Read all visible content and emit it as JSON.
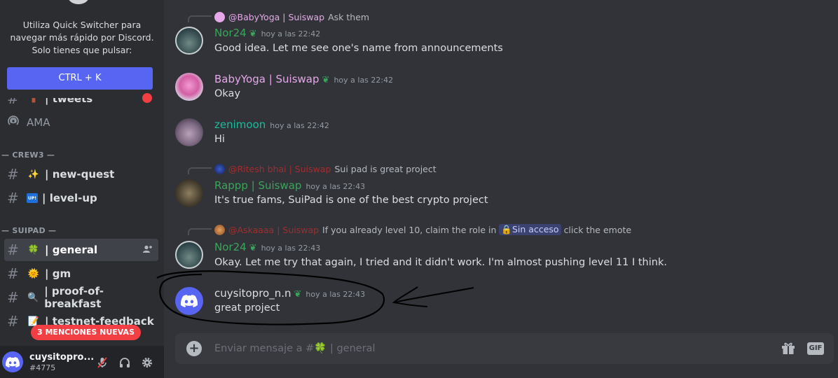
{
  "quick_switcher": {
    "line1": "Utiliza Quick Switcher para",
    "line2": "navegar más rápido por Discord.",
    "line3": "Solo tienes que pulsar:",
    "button": "CTRL + K"
  },
  "sidebar": {
    "partial_channel": "| tweets",
    "ama": "AMA",
    "categories": [
      "— CREW3 —",
      "— SUIPAD —"
    ],
    "crew3_channels": [
      {
        "emoji": "✨",
        "name": "| new-quest"
      },
      {
        "emoji": "UP!",
        "name": "| level-up"
      }
    ],
    "suipad_channels": [
      {
        "emoji": "🍀",
        "name": "| general"
      },
      {
        "emoji": "🌞",
        "name": "| gm"
      },
      {
        "emoji": "🔍",
        "name": "| proof-of-breakfast"
      },
      {
        "emoji": "📝",
        "name": "| testnet-feedback"
      }
    ],
    "mentions_pill": "3 MENCIONES NUEVAS"
  },
  "user": {
    "name": "cuysitopro...",
    "tag": "#4775"
  },
  "messages": [
    {
      "reply": {
        "name": "@BabyYoga | Suiswap",
        "text": "Ask them"
      },
      "author": "Nor24",
      "time": "hoy a las 22:42",
      "text": "Good idea. Let me see one's name from announcements",
      "author_color": "#3ba55c"
    },
    {
      "author": "BabyYoga | Suiswap",
      "time": "hoy a las 22:42",
      "text": "Okay",
      "author_color": "#e6a8e9"
    },
    {
      "author": "zenimoon",
      "time": "hoy a las 22:42",
      "text": "Hi",
      "author_color": "#1abc9c"
    },
    {
      "reply": {
        "name": "@Ritesh bhai | Suiswap",
        "text": "Sui pad is great project"
      },
      "author": "Rappp | Suiswap",
      "time": "hoy a las 22:43",
      "text": "It's true fams, SuiPad is one of the best crypto project",
      "author_color": "#3ba55c"
    },
    {
      "reply": {
        "name": "@Askaaaa | Suiswap",
        "text_before": "If you already level 10, claim the role in",
        "lock": "Sin acceso",
        "text_after": "click the emote"
      },
      "author": "Nor24",
      "time": "hoy a las 22:43",
      "text": "Okay. Let me try that again, I tried and it didn't work. I'm almost pushing level 11 I think.",
      "author_color": "#3ba55c"
    },
    {
      "author": "cuysitopro_n.n",
      "time": "hoy a las 22:43",
      "text": "great project",
      "author_color": "#dbdee1"
    }
  ],
  "composer": {
    "placeholder_prefix": "Enviar mensaje a #",
    "placeholder_emoji": "🍀",
    "placeholder_suffix": " | general",
    "gif_label": "GIF"
  },
  "colors": {
    "blurple": "#5865f2",
    "danger": "#f23f43",
    "reply_name_red": "#a12d2f"
  }
}
